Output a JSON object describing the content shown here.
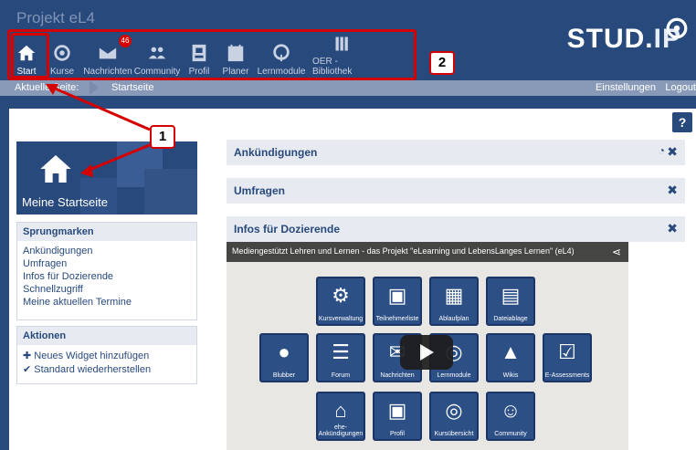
{
  "header": {
    "project_title": "Projekt eL4",
    "logo_main": "STUD.",
    "logo_ip": "IP",
    "nav": [
      {
        "label": "Start",
        "icon": "home-icon",
        "active": true
      },
      {
        "label": "Kurse",
        "icon": "courses-icon"
      },
      {
        "label": "Nachrichten",
        "icon": "mail-icon",
        "badge": "46"
      },
      {
        "label": "Community",
        "icon": "community-icon"
      },
      {
        "label": "Profil",
        "icon": "profile-icon"
      },
      {
        "label": "Planer",
        "icon": "calendar-icon"
      },
      {
        "label": "Lernmodule",
        "icon": "learning-icon"
      },
      {
        "label": "OER - Bibliothek",
        "icon": "library-icon"
      }
    ]
  },
  "breadcrumb": {
    "current_label": "Aktuelle Seite:",
    "current_page": "Startseite",
    "settings": "Einstellungen",
    "logout": "Logout"
  },
  "markers": {
    "one": "1",
    "two": "2"
  },
  "sidebar": {
    "title": "Meine Startseite",
    "jump": {
      "heading": "Sprungmarken",
      "items": [
        "Ankündigungen",
        "Umfragen",
        "Infos für Dozierende",
        "Schnellzugriff",
        "Meine aktuellen Termine"
      ]
    },
    "actions": {
      "heading": "Aktionen",
      "items": [
        "Neues Widget hinzufügen",
        "Standard wiederherstellen"
      ]
    }
  },
  "widgets": [
    {
      "title": "Ankündigungen"
    },
    {
      "title": "Umfragen"
    },
    {
      "title": "Infos für Dozierende"
    }
  ],
  "video": {
    "title": "Mediengestützt Lehren und Lernen - das Projekt \"eLearning und LebensLanges Lernen\" (eL4)",
    "tiles": [
      "Kursverwaltung",
      "Teilnehmerliste",
      "Ablaufplan",
      "Dateiablage",
      "Blubber",
      "Forum",
      "Nachrichten",
      "Lernmodule",
      "Wikis",
      "E-Assessments",
      "ehe-Ankündigungen",
      "Profil",
      "Kursübersicht",
      "Community"
    ]
  },
  "colors": {
    "brand": "#28497c",
    "accent": "#d40000",
    "panel_bg": "#e7ebf1"
  }
}
